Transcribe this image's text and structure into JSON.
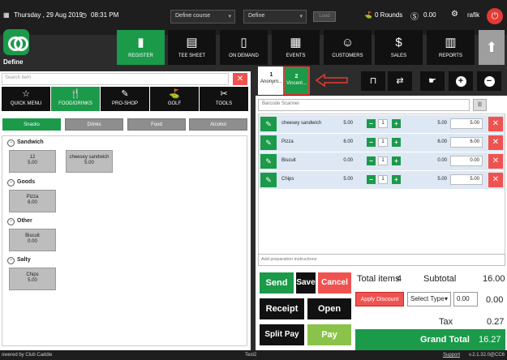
{
  "topbar": {
    "date": "Thursday , 29 Aug 2019",
    "time": "08:31 PM",
    "course_select": "Define course",
    "define_select": "Define",
    "load_label": "Load",
    "rounds": "0 Rounds",
    "balance": "0.00",
    "user": "rafik"
  },
  "brand": {
    "name": "Define"
  },
  "nav": [
    {
      "label": "REGISTER",
      "icon": "scanner-icon"
    },
    {
      "label": "TEE SHEET",
      "icon": "calendar-icon"
    },
    {
      "label": "ON DEMAND",
      "icon": "phone-icon"
    },
    {
      "label": "EVENTS",
      "icon": "calendar-edit-icon"
    },
    {
      "label": "CUSTOMERS",
      "icon": "users-icon"
    },
    {
      "label": "SALES",
      "icon": "money-icon"
    },
    {
      "label": "REPORTS",
      "icon": "report-icon"
    }
  ],
  "left": {
    "search_placeholder": "Search item",
    "categories": [
      {
        "label": "QUICK MENU",
        "icon": "star-icon"
      },
      {
        "label": "FOOD/DRINKS",
        "icon": "food-icon"
      },
      {
        "label": "PRO-SHOP",
        "icon": "shop-icon"
      },
      {
        "label": "GOLF",
        "icon": "golf-icon"
      },
      {
        "label": "TOOLS",
        "icon": "tools-icon"
      }
    ],
    "subtabs": [
      "Snacks",
      "Drinks",
      "Food",
      "Alcohol"
    ],
    "groups": [
      {
        "name": "Sandwich",
        "items": [
          {
            "name": "12",
            "price": "5.00"
          },
          {
            "name": "cheesey sandwich",
            "price": "5.00"
          }
        ]
      },
      {
        "name": "Goods",
        "items": [
          {
            "name": "Pizza",
            "price": "6.00"
          }
        ]
      },
      {
        "name": "Other",
        "items": [
          {
            "name": "Biscuit",
            "price": "0.00"
          }
        ]
      },
      {
        "name": "Salty",
        "items": [
          {
            "name": "Chips",
            "price": "5.00"
          }
        ]
      }
    ]
  },
  "tabs": [
    {
      "num": "1",
      "name": "Anonym..."
    },
    {
      "num": "2",
      "name": "Vincent..."
    }
  ],
  "right": {
    "barcode_placeholder": "Barcode Scanner",
    "barcode_button": "|||",
    "order": [
      {
        "name": "cheesey sandwich",
        "price": "5.00",
        "qty": "1",
        "total": "5.00",
        "total_input": "5.00"
      },
      {
        "name": "Pizza",
        "price": "6.00",
        "qty": "1",
        "total": "6.00",
        "total_input": "6.00"
      },
      {
        "name": "Biscuit",
        "price": "0.00",
        "qty": "1",
        "total": "0.00",
        "total_input": "0.00"
      },
      {
        "name": "Chips",
        "price": "5.00",
        "qty": "1",
        "total": "5.00",
        "total_input": "5.00"
      }
    ],
    "prep_placeholder": "Add preparation instructions"
  },
  "actions": {
    "send": "Send",
    "save": "Save",
    "cancel": "Cancel",
    "receipt": "Receipt",
    "open": "Open",
    "split_pay": "Split Pay",
    "pay": "Pay"
  },
  "summary": {
    "total_items_label": "Total items",
    "total_items": "4",
    "subtotal_label": "Subtotal",
    "subtotal": "16.00",
    "apply_discount": "Apply Discount",
    "select_type": "Select Type",
    "discount_value": "0.00",
    "discount_amount": "0.00",
    "tax_label": "Tax",
    "tax": "0.27",
    "grand_label": "Grand Total",
    "grand": "16.27"
  },
  "footer": {
    "powered": "owered by Club Caddie",
    "terminal": "Test2",
    "support": "Support",
    "version": "v.2.1.32.0@CC6"
  },
  "colors": {
    "accent": "#1b9a4a",
    "danger": "#ef5350",
    "dark": "#111111"
  }
}
